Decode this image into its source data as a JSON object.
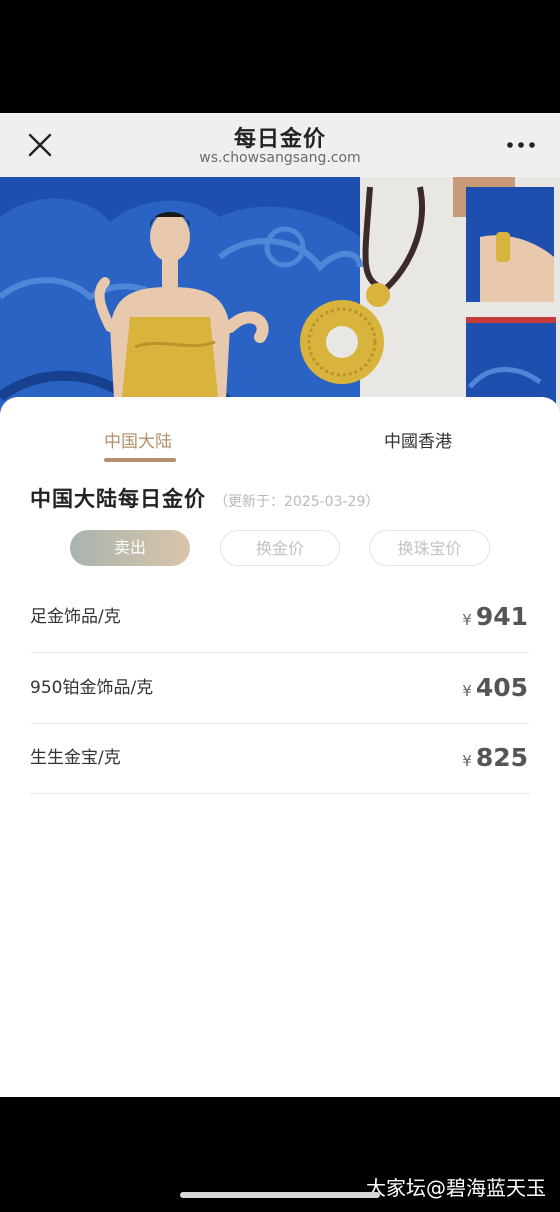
{
  "header": {
    "title": "每日金价",
    "url": "ws.chowsangsang.com"
  },
  "tabs": [
    {
      "label": "中国大陆",
      "active": true
    },
    {
      "label": "中國香港",
      "active": false
    }
  ],
  "section": {
    "title": "中国大陆每日金价",
    "updated": "（更新于：2025-03-29）"
  },
  "filters": [
    {
      "label": "卖出",
      "active": true
    },
    {
      "label": "换金价",
      "active": false
    },
    {
      "label": "换珠宝价",
      "active": false
    }
  ],
  "prices": [
    {
      "label": "足金饰品/克",
      "currency": "¥",
      "value": "941"
    },
    {
      "label": "950铂金饰品/克",
      "currency": "¥",
      "value": "405"
    },
    {
      "label": "生生金宝/克",
      "currency": "¥",
      "value": "825"
    }
  ],
  "watermark": "大家坛@碧海蓝天玉",
  "colors": {
    "accent": "#b3906a",
    "banner_blue": "#1f4fae",
    "gold": "#d8b43c"
  }
}
